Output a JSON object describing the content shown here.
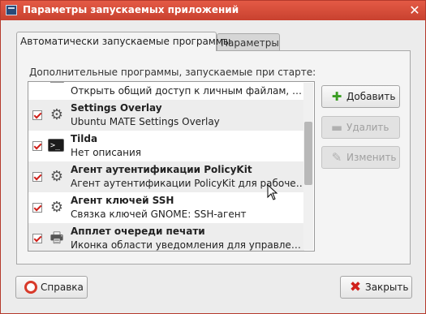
{
  "window": {
    "title": "Параметры запускаемых приложений",
    "close_glyph": "✕"
  },
  "tabs": [
    {
      "label": "Автоматически запускаемые программы",
      "active": true
    },
    {
      "label": "Параметры",
      "active": false
    }
  ],
  "section_label": "Дополнительные программы, запускаемые при старте:",
  "startup_items": [
    {
      "name": "",
      "description": "Открыть общий доступ к личным файлам, если ...",
      "icon": "network-share-icon",
      "checked": true
    },
    {
      "name": "Settings Overlay",
      "description": "Ubuntu MATE Settings Overlay",
      "icon": "gears-icon",
      "checked": true
    },
    {
      "name": "Tilda",
      "description": "Нет описания",
      "icon": "terminal-icon",
      "checked": true
    },
    {
      "name": "Агент аутентификации PolicyKit",
      "description": "Агент аутентификации PolicyKit для рабочей ср...",
      "icon": "gears-icon",
      "checked": true
    },
    {
      "name": "Агент ключей SSH",
      "description": "Связка ключей GNOME: SSH-агент",
      "icon": "gears-icon",
      "checked": true
    },
    {
      "name": "Апплет очереди печати",
      "description": "Иконка области уведомления для управления з...",
      "icon": "printer-icon",
      "checked": true
    }
  ],
  "buttons": {
    "add": "Добавить",
    "remove": "Удалить",
    "edit": "Изменить",
    "help": "Справка",
    "close": "Закрыть"
  },
  "colors": {
    "titlebar": "#d64a38",
    "checkbox_mark": "#d0201a",
    "add_icon": "#3a9d23"
  }
}
